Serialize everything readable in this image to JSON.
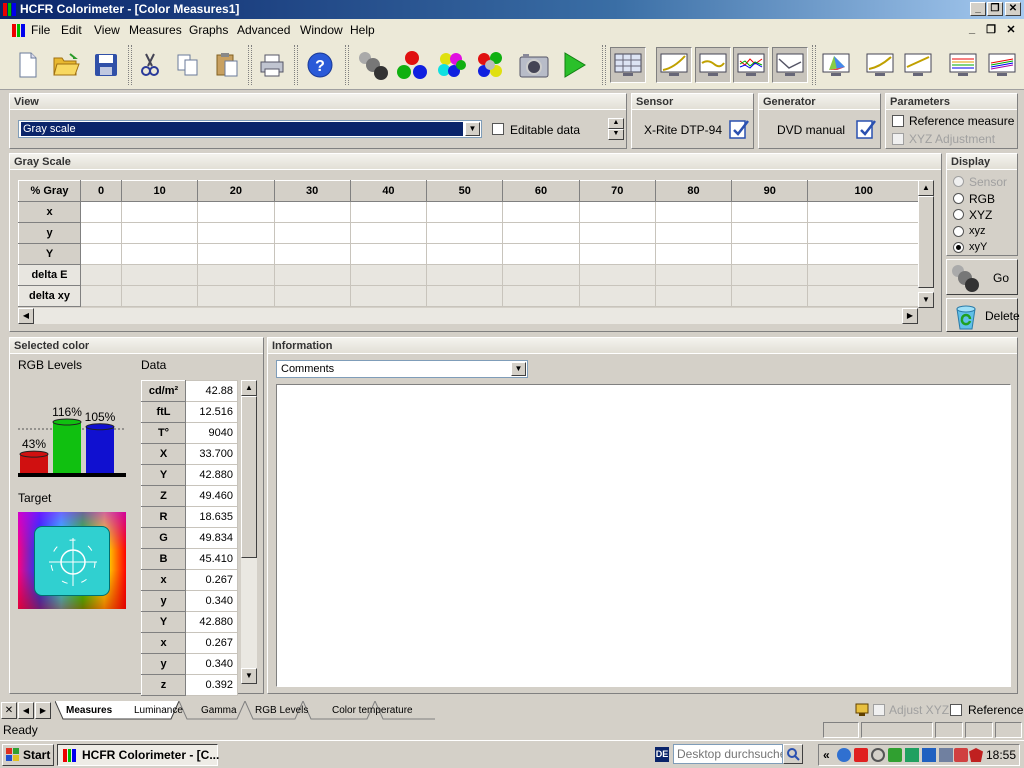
{
  "app": {
    "title": "HCFR Colorimeter - [Color Measures1]"
  },
  "menu": {
    "items": [
      "File",
      "Edit",
      "View",
      "Measures",
      "Graphs",
      "Advanced",
      "Window",
      "Help"
    ]
  },
  "view_panel": {
    "header": "View",
    "selected": "Gray scale",
    "editable_label": "Editable data"
  },
  "sensor_panel": {
    "header": "Sensor",
    "value": "X-Rite DTP-94"
  },
  "generator_panel": {
    "header": "Generator",
    "value": "DVD manual"
  },
  "parameters_panel": {
    "header": "Parameters",
    "reference_measure": "Reference measure",
    "xyz_adjustment": "XYZ Adjustment"
  },
  "grayscale": {
    "header": "Gray Scale",
    "corner": "% Gray",
    "columns": [
      "0",
      "10",
      "20",
      "30",
      "40",
      "50",
      "60",
      "70",
      "80",
      "90",
      "100"
    ],
    "rows": [
      "x",
      "y",
      "Y",
      "delta E",
      "delta xy"
    ]
  },
  "display_panel": {
    "header": "Display",
    "options": [
      "Sensor",
      "RGB",
      "XYZ",
      "xyz",
      "xyY"
    ],
    "selected": "xyY"
  },
  "actions": {
    "go": "Go",
    "delete": "Delete"
  },
  "selected_color": {
    "header": "Selected color",
    "rgb_levels_label": "RGB Levels",
    "data_label": "Data",
    "target_label": "Target",
    "levels": [
      {
        "label": "43%",
        "value": 43,
        "color": "#d01010"
      },
      {
        "label": "116%",
        "value": 116,
        "color": "#10c010"
      },
      {
        "label": "105%",
        "value": 105,
        "color": "#1010d0"
      }
    ],
    "data": [
      {
        "k": "cd/m²",
        "v": "42.88"
      },
      {
        "k": "ftL",
        "v": "12.516"
      },
      {
        "k": "T°",
        "v": "9040"
      },
      {
        "k": "X",
        "v": "33.700"
      },
      {
        "k": "Y",
        "v": "42.880"
      },
      {
        "k": "Z",
        "v": "49.460"
      },
      {
        "k": "R",
        "v": "18.635"
      },
      {
        "k": "G",
        "v": "49.834"
      },
      {
        "k": "B",
        "v": "45.410"
      },
      {
        "k": "x",
        "v": "0.267"
      },
      {
        "k": "y",
        "v": "0.340"
      },
      {
        "k": "Y",
        "v": "42.880"
      },
      {
        "k": "x",
        "v": "0.267"
      },
      {
        "k": "y",
        "v": "0.340"
      },
      {
        "k": "z",
        "v": "0.392"
      }
    ]
  },
  "information": {
    "header": "Information",
    "selected": "Comments"
  },
  "tabs": [
    "Measures",
    "Luminance",
    "Gamma",
    "RGB Levels",
    "Color temperature"
  ],
  "tab_options": {
    "adjust_xyz": "Adjust XYZ",
    "reference": "Reference"
  },
  "status": {
    "text": "Ready"
  },
  "taskbar": {
    "start": "Start",
    "task": "HCFR Colorimeter - [C...",
    "lang": "DE",
    "search_placeholder": "Desktop durchsuchen",
    "time": "18:55"
  }
}
